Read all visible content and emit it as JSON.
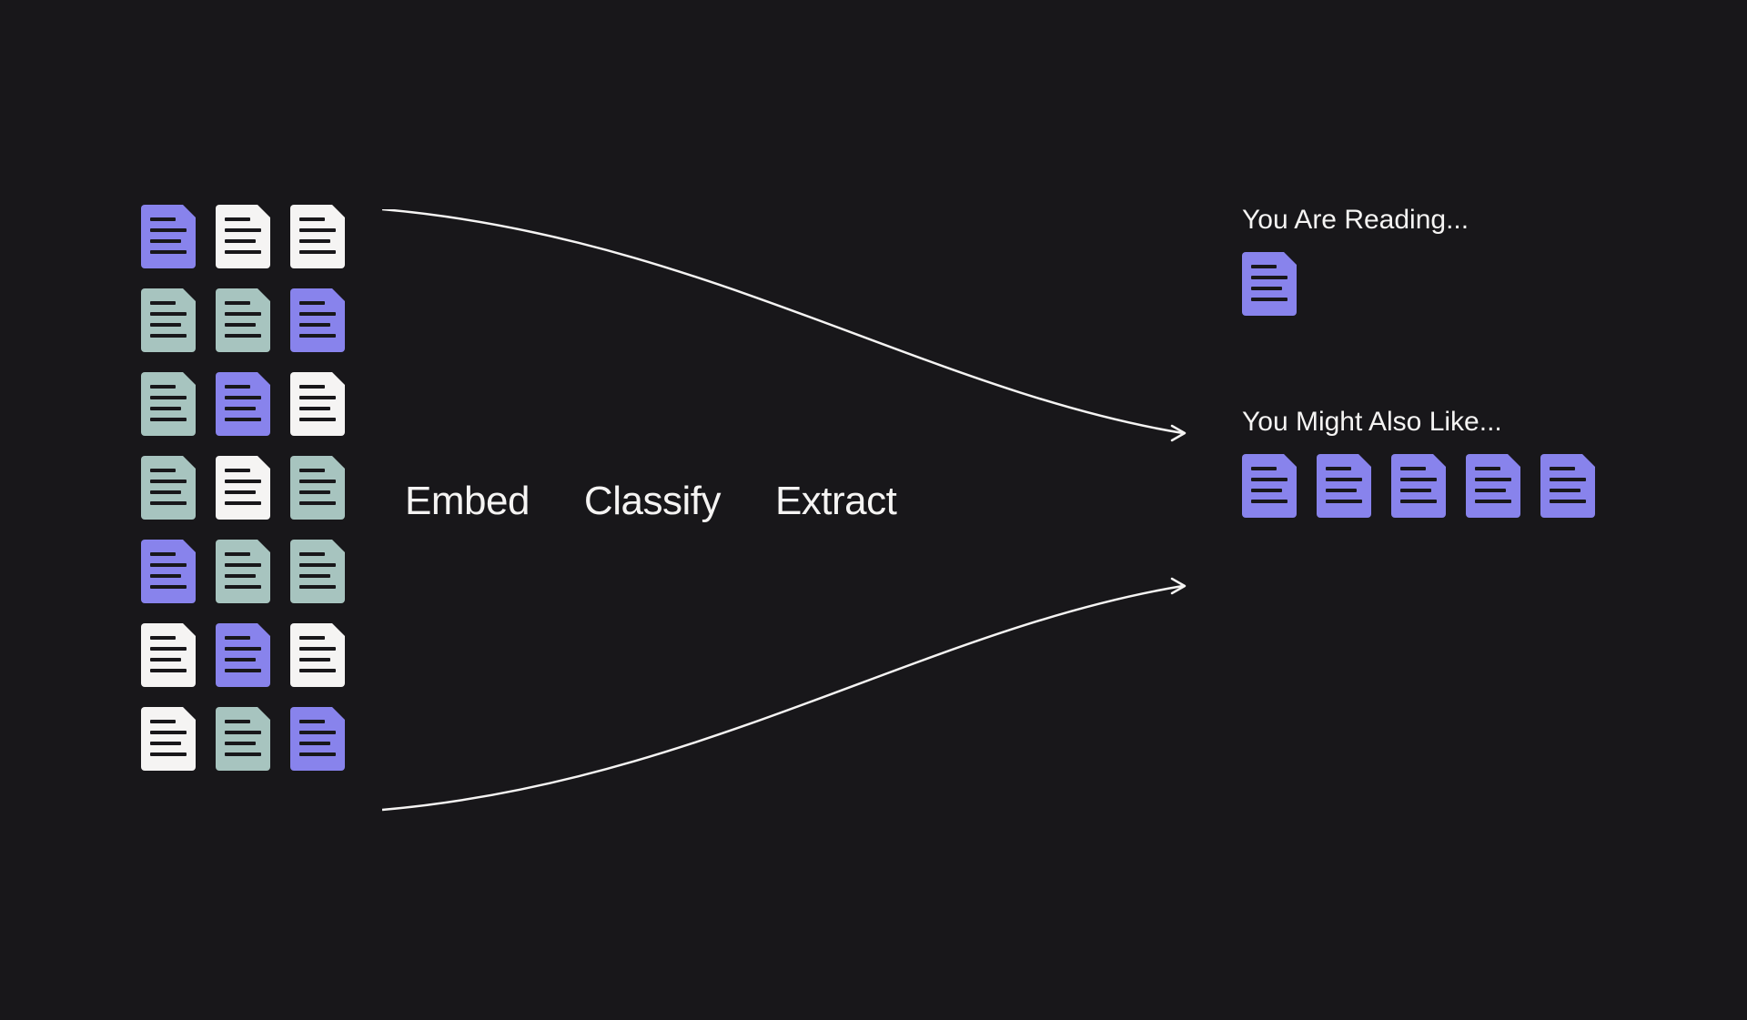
{
  "input_docs_grid": [
    [
      "purple",
      "white",
      "white"
    ],
    [
      "teal",
      "teal",
      "purple"
    ],
    [
      "teal",
      "purple",
      "white"
    ],
    [
      "teal",
      "white",
      "teal"
    ],
    [
      "purple",
      "teal",
      "teal"
    ],
    [
      "white",
      "purple",
      "white"
    ],
    [
      "white",
      "teal",
      "purple"
    ]
  ],
  "pipeline": {
    "step1": "Embed",
    "step2": "Classify",
    "step3": "Extract"
  },
  "reading": {
    "title": "You Are Reading...",
    "doc_color": "purple"
  },
  "recommendations": {
    "title": "You Might Also Like...",
    "docs": [
      "purple",
      "purple",
      "purple",
      "purple",
      "purple"
    ]
  },
  "colors": {
    "purple": "#8883ec",
    "white": "#f5f4f3",
    "teal": "#a7c4bf",
    "background": "#18171a"
  }
}
